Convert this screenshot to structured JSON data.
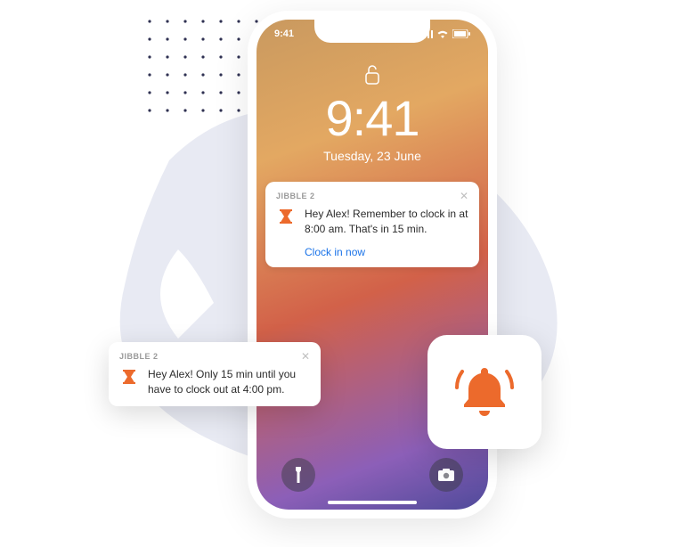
{
  "status": {
    "time": "9:41"
  },
  "lockscreen": {
    "time": "9:41",
    "date": "Tuesday, 23 June"
  },
  "notification1": {
    "app": "JIBBLE 2",
    "message": "Hey Alex! Remember to clock in at 8:00 am. That's in 15 min.",
    "action": "Clock in now"
  },
  "notification2": {
    "app": "JIBBLE 2",
    "message": "Hey Alex! Only 15 min until you have to clock out at 4:00 pm."
  },
  "colors": {
    "accent": "#ec6a2c",
    "link": "#1a73e8"
  }
}
